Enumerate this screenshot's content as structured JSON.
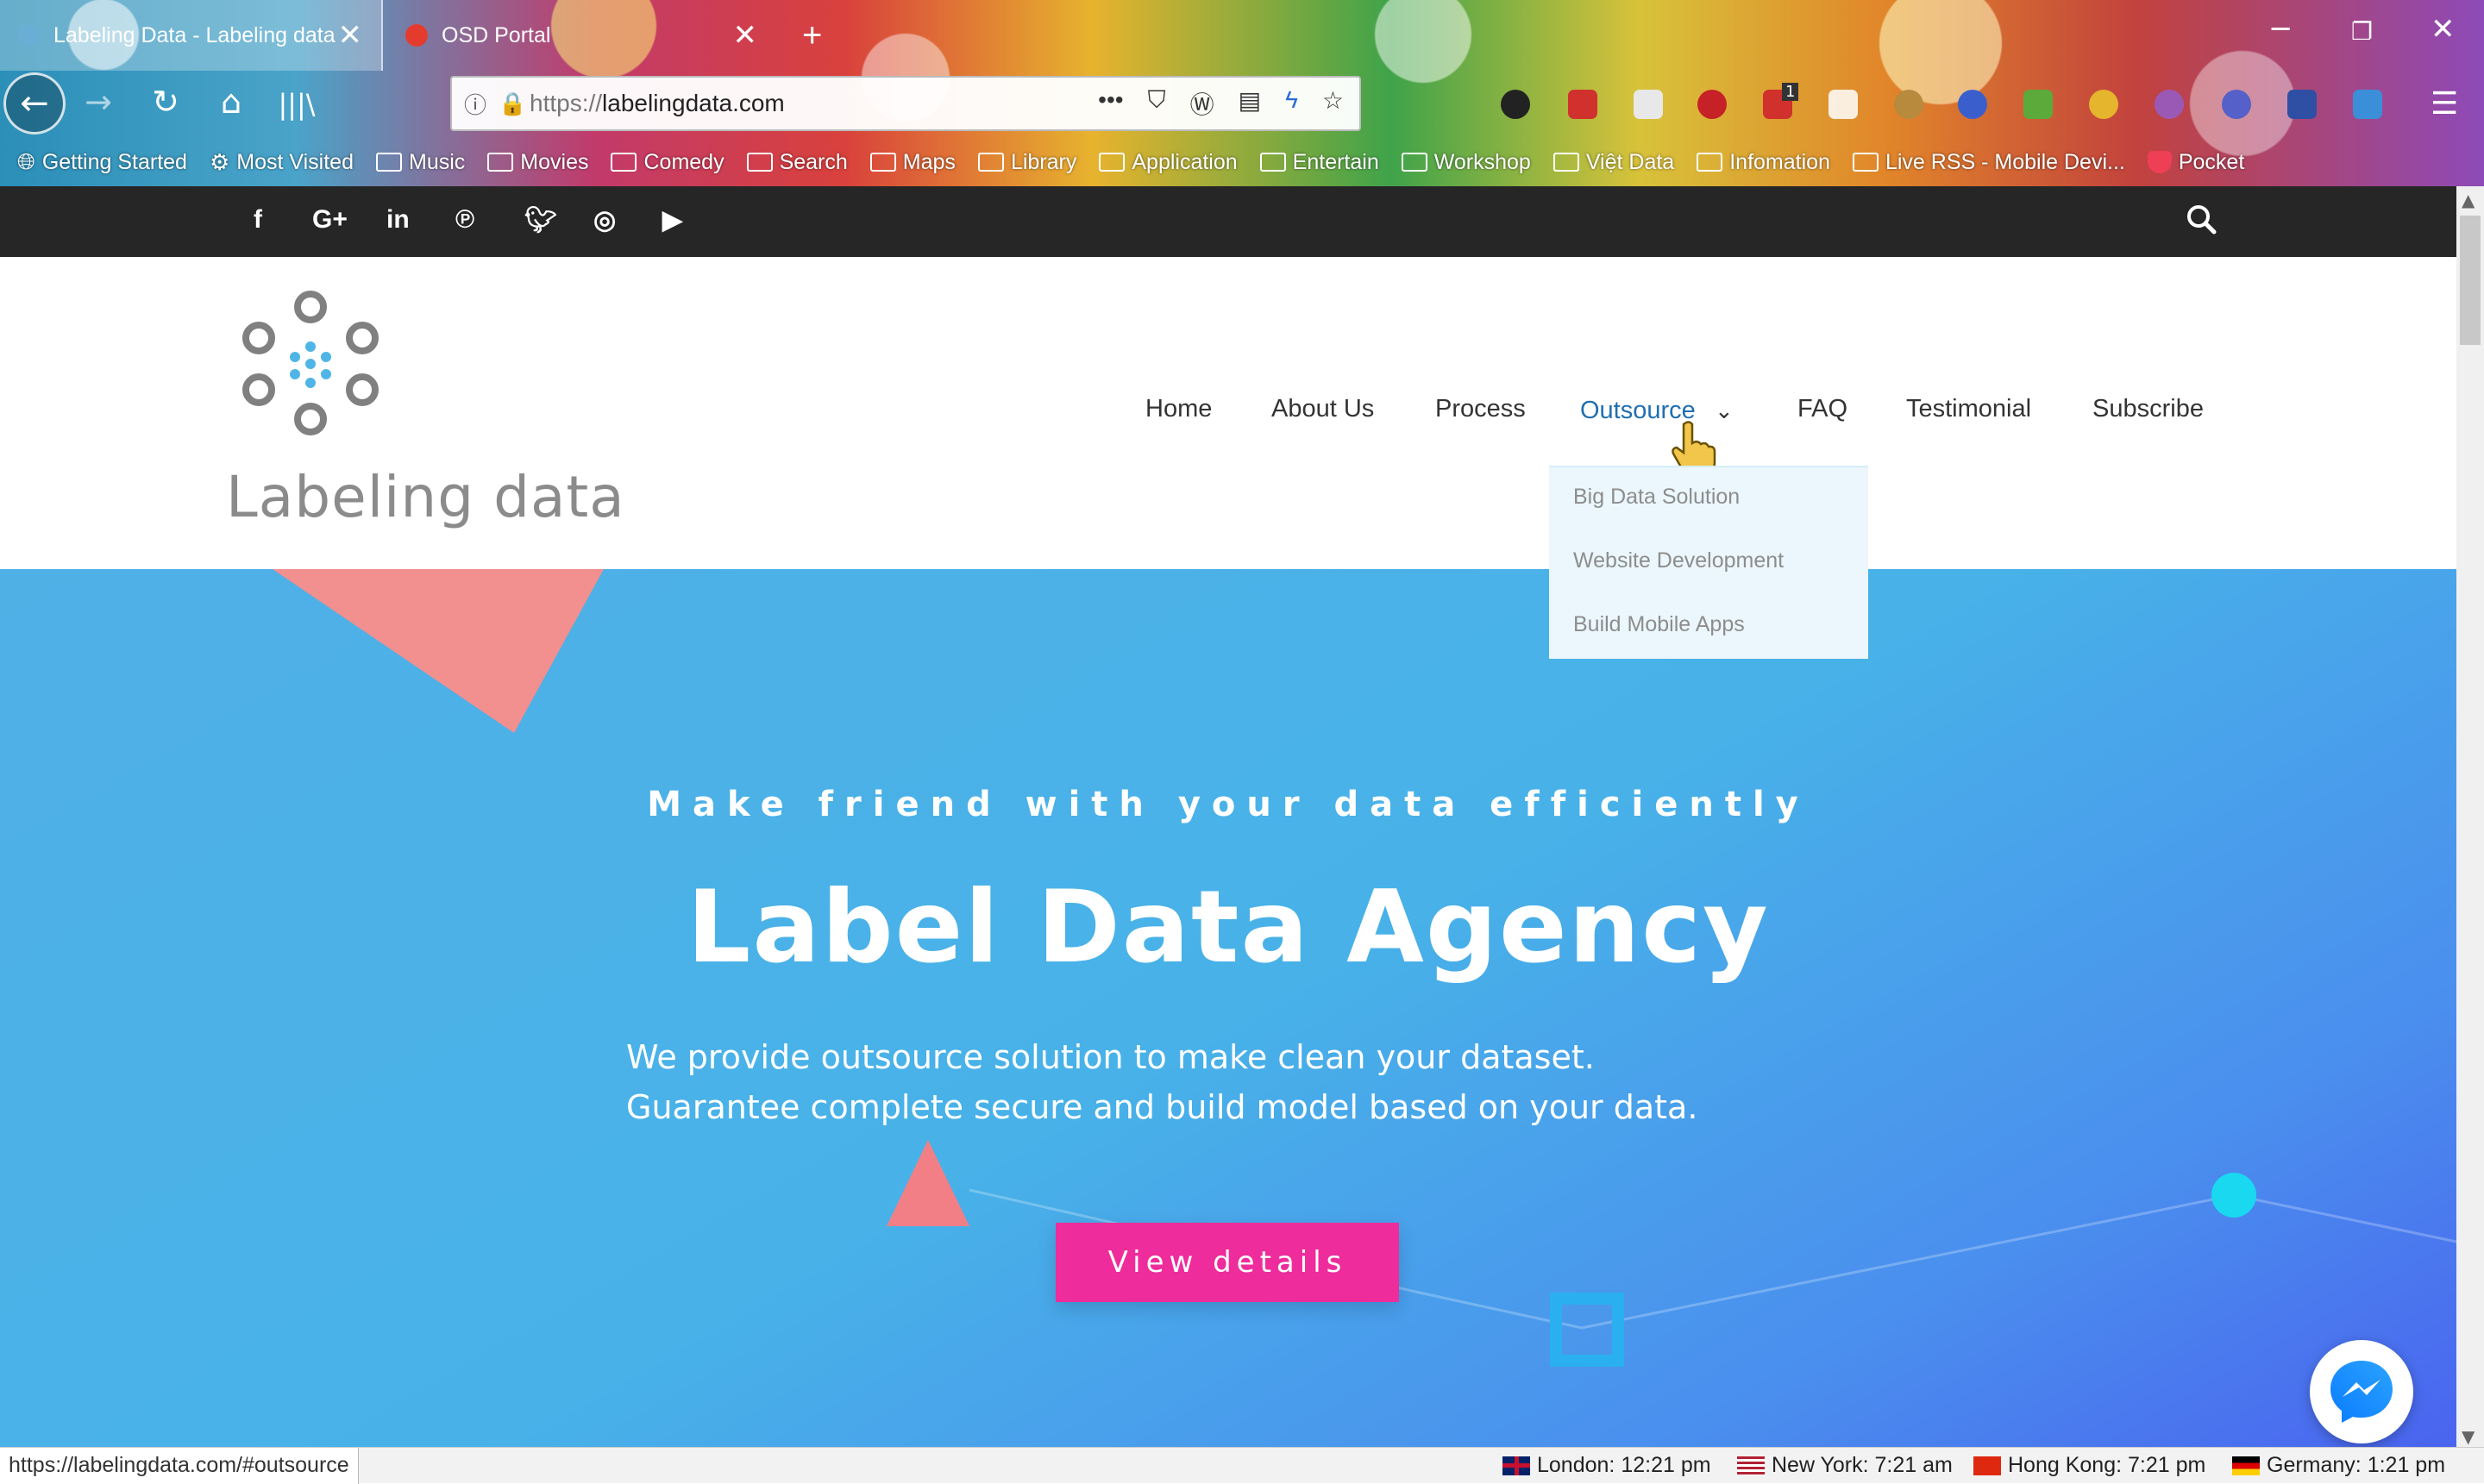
{
  "browser": {
    "tabs": [
      {
        "title": "Labeling Data - Labeling data",
        "active": true
      },
      {
        "title": "OSD Portal",
        "active": false
      }
    ],
    "new_tab": "+",
    "address": {
      "protocol": "https://",
      "host": "labelingdata.com"
    },
    "bookmarks": [
      {
        "label": "Getting Started",
        "icon": "globe-icon"
      },
      {
        "label": "Most Visited",
        "icon": "gear-icon"
      },
      {
        "label": "Music",
        "icon": "folder-icon"
      },
      {
        "label": "Movies",
        "icon": "folder-icon"
      },
      {
        "label": "Comedy",
        "icon": "folder-icon"
      },
      {
        "label": "Search",
        "icon": "folder-icon"
      },
      {
        "label": "Maps",
        "icon": "folder-icon"
      },
      {
        "label": "Library",
        "icon": "folder-icon"
      },
      {
        "label": "Application",
        "icon": "folder-icon"
      },
      {
        "label": "Entertain",
        "icon": "folder-icon"
      },
      {
        "label": "Workshop",
        "icon": "folder-icon"
      },
      {
        "label": "Việt Data",
        "icon": "folder-icon"
      },
      {
        "label": "Infomation",
        "icon": "folder-icon"
      },
      {
        "label": "Live RSS - Mobile Devi...",
        "icon": "folder-icon"
      },
      {
        "label": "Pocket",
        "icon": "pocket-icon"
      }
    ],
    "extension_badge": "1"
  },
  "site": {
    "social": [
      "facebook-icon",
      "google-plus-icon",
      "linkedin-icon",
      "pinterest-icon",
      "twitter-icon",
      "instagram-icon",
      "youtube-icon"
    ],
    "logo_text": "Labeling data",
    "nav": [
      {
        "label": "Home"
      },
      {
        "label": "About Us"
      },
      {
        "label": "Process"
      },
      {
        "label": "Outsource",
        "active": true
      },
      {
        "label": "FAQ"
      },
      {
        "label": "Testimonial"
      },
      {
        "label": "Subscribe"
      }
    ],
    "dropdown": [
      "Big Data Solution",
      "Website Development",
      "Build Mobile Apps"
    ],
    "hero": {
      "tagline": "Make friend with your data efficiently",
      "title": "Label Data Agency",
      "line1": "We provide outsource solution to make clean your dataset.",
      "line2": "Guarantee complete secure and build model based on your data.",
      "button": "View details"
    },
    "colors": {
      "hero_blue": "#48b2e8",
      "button_pink": "#ee2c9b",
      "topbar": "#262626",
      "logo_dot": "#4fb5e6"
    }
  },
  "status": {
    "url": "https://labelingdata.com/#outsource",
    "clocks": [
      {
        "label": "London: 12:21 pm"
      },
      {
        "label": "New York: 7:21 am"
      },
      {
        "label": "Hong Kong: 7:21 pm"
      },
      {
        "label": "Germany: 1:21 pm"
      }
    ]
  }
}
